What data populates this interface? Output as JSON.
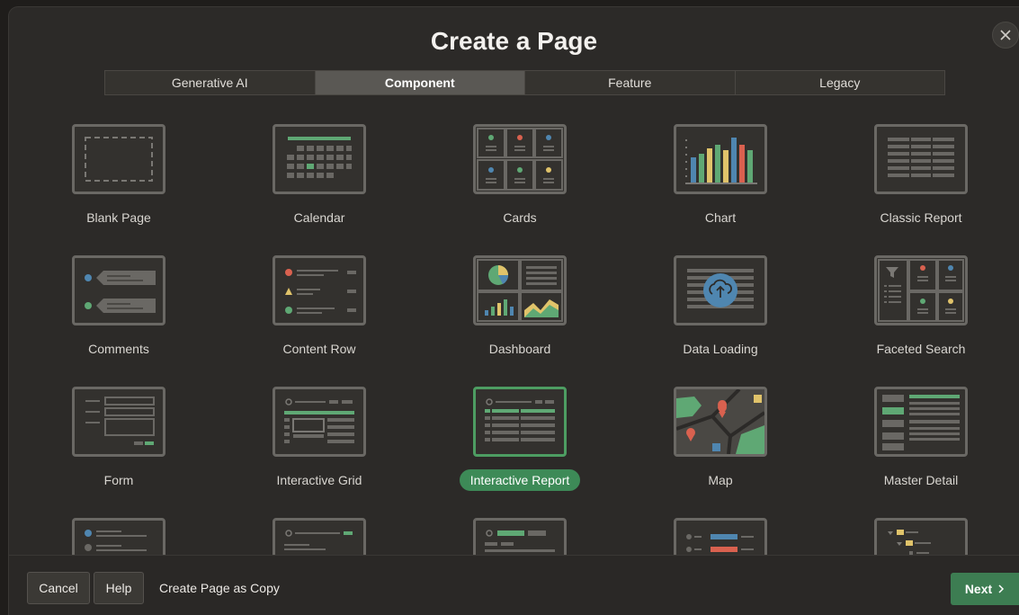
{
  "dialog": {
    "title": "Create a Page"
  },
  "tabs": [
    {
      "label": "Generative AI"
    },
    {
      "label": "Component"
    },
    {
      "label": "Feature"
    },
    {
      "label": "Legacy"
    }
  ],
  "active_tab": "Component",
  "tiles": [
    {
      "label": "Blank Page",
      "icon": "blank-page-icon"
    },
    {
      "label": "Calendar",
      "icon": "calendar-icon"
    },
    {
      "label": "Cards",
      "icon": "cards-icon"
    },
    {
      "label": "Chart",
      "icon": "chart-icon"
    },
    {
      "label": "Classic Report",
      "icon": "classic-report-icon"
    },
    {
      "label": "Comments",
      "icon": "comments-icon"
    },
    {
      "label": "Content Row",
      "icon": "content-row-icon"
    },
    {
      "label": "Dashboard",
      "icon": "dashboard-icon"
    },
    {
      "label": "Data Loading",
      "icon": "data-loading-icon"
    },
    {
      "label": "Faceted Search",
      "icon": "faceted-search-icon"
    },
    {
      "label": "Form",
      "icon": "form-icon"
    },
    {
      "label": "Interactive Grid",
      "icon": "interactive-grid-icon"
    },
    {
      "label": "Interactive Report",
      "icon": "interactive-report-icon",
      "selected": true
    },
    {
      "label": "Map",
      "icon": "map-icon"
    },
    {
      "label": "Master Detail",
      "icon": "master-detail-icon"
    }
  ],
  "footer": {
    "cancel_label": "Cancel",
    "help_label": "Help",
    "copy_label": "Create Page as Copy",
    "next_label": "Next"
  },
  "colors": {
    "accent_green": "#3d8a57",
    "selected_border": "#4d9d62",
    "background": "#2c2a28"
  }
}
